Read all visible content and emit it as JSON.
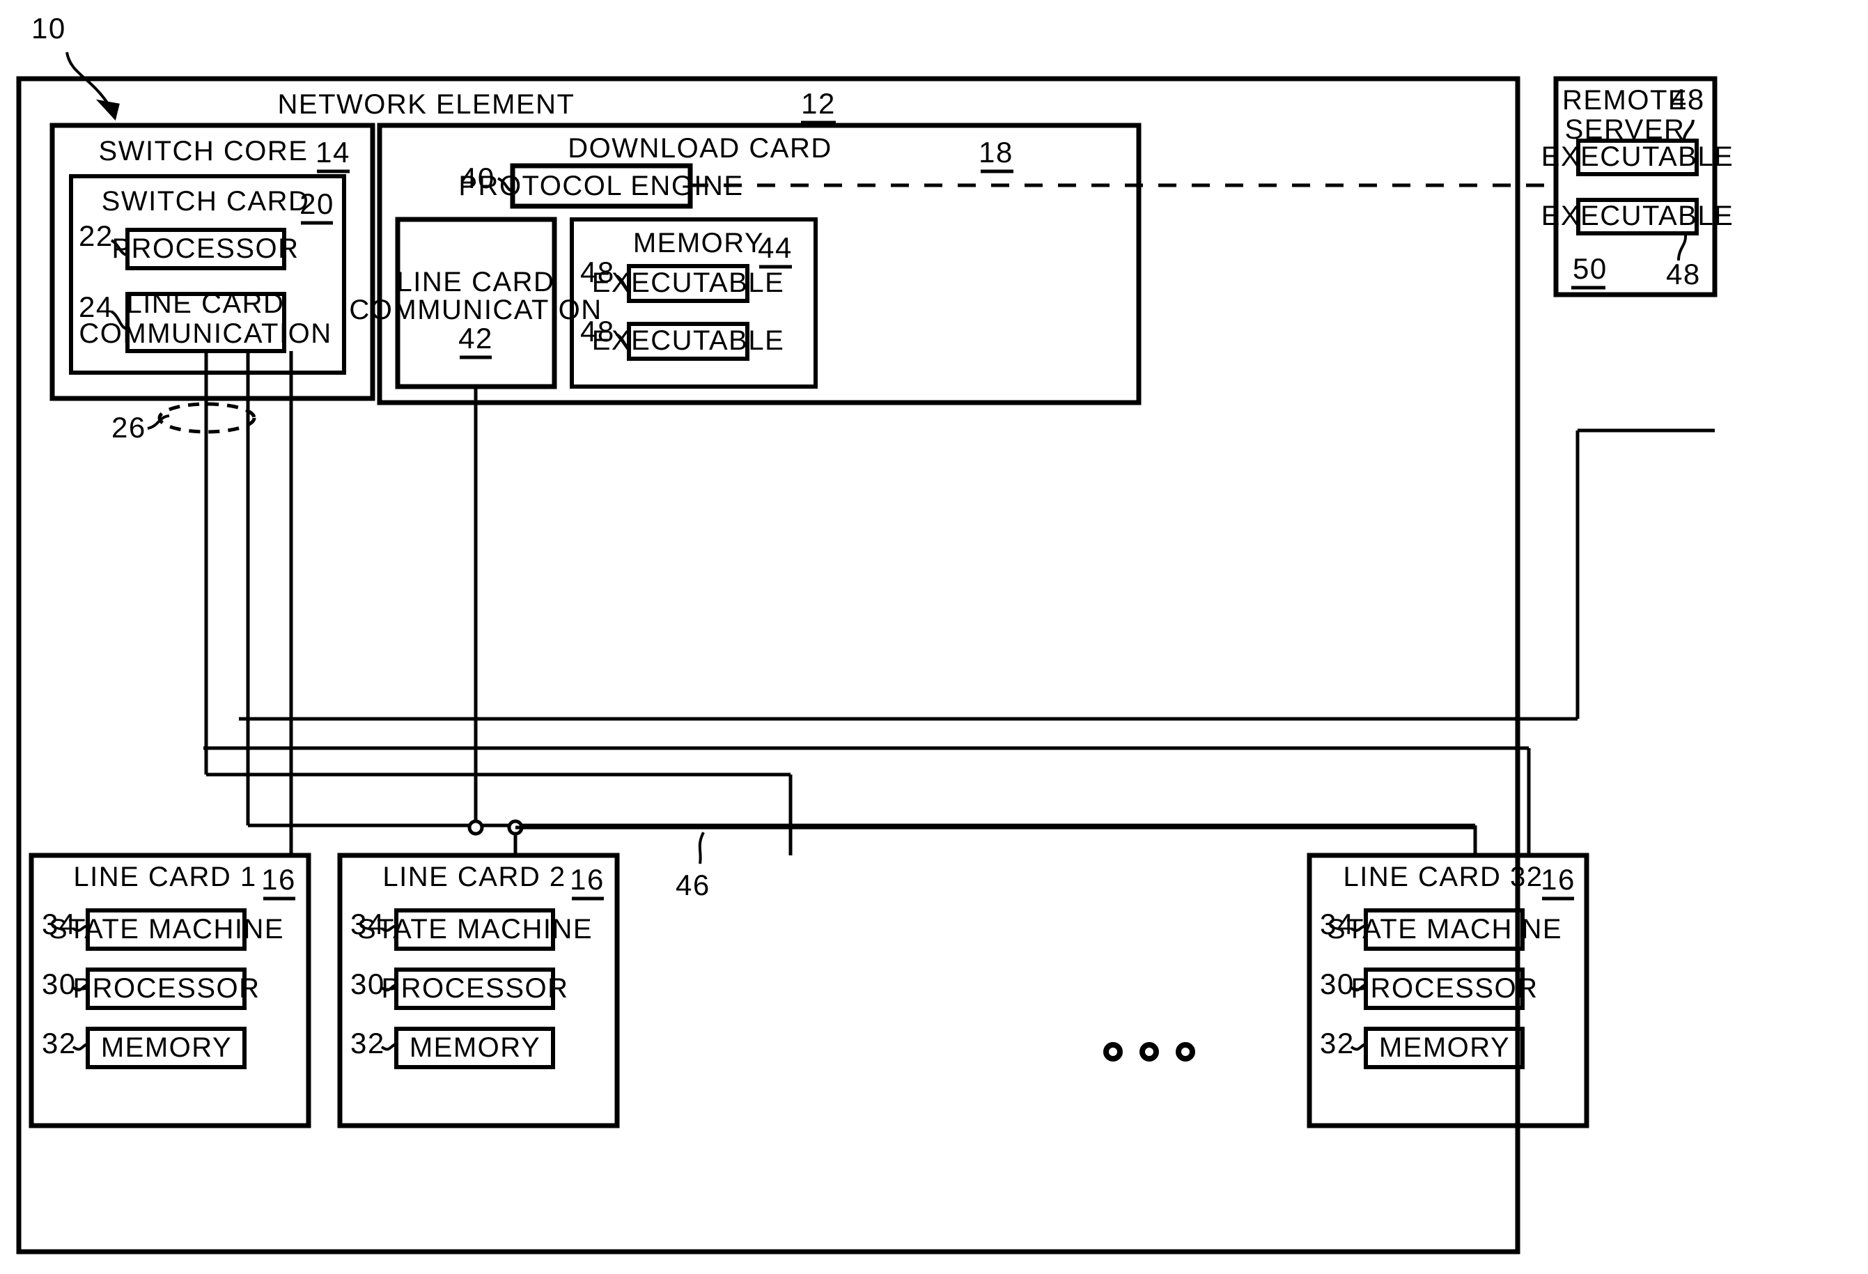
{
  "figure": {
    "root_ref": "10",
    "network_element": {
      "title": "NETWORK ELEMENT",
      "ref": "12"
    },
    "switch_core": {
      "title": "SWITCH CORE",
      "ref": "14",
      "switch_card": {
        "title": "SWITCH CARD",
        "ref": "20",
        "blocks": [
          {
            "label": "PROCESSOR",
            "ref": "22"
          },
          {
            "label": "LINE CARD\nCOMMUNICATION",
            "label_line1": "LINE CARD",
            "label_line2": "COMMUNICATION",
            "ref": "24"
          }
        ]
      }
    },
    "download_card": {
      "title": "DOWNLOAD CARD",
      "ref": "18",
      "protocol_engine": {
        "label": "PROTOCOL ENGINE",
        "ref": "40"
      },
      "line_card_communication": {
        "label_line1": "LINE CARD",
        "label_line2": "COMMUNICATION",
        "ref": "42"
      },
      "memory": {
        "title": "MEMORY",
        "ref": "44",
        "executables": [
          {
            "label": "EXECUTABLE",
            "ref": "48"
          },
          {
            "label": "EXECUTABLE",
            "ref": "48"
          }
        ]
      }
    },
    "remote_server": {
      "title_line1": "REMOTE",
      "title_line2": "SERVER",
      "ref": "50",
      "top_ref": "48",
      "bottom_ref": "48",
      "executables": [
        {
          "label": "EXECUTABLE"
        },
        {
          "label": "EXECUTABLE"
        }
      ]
    },
    "bus": {
      "ref": "26"
    },
    "download_bus": {
      "ref": "46"
    },
    "ellipsis": "o o o",
    "line_cards": [
      {
        "title": "LINE CARD 1",
        "ref": "16",
        "blocks": [
          {
            "label": "STATE MACHINE",
            "ref": "34"
          },
          {
            "label": "PROCESSOR",
            "ref": "30"
          },
          {
            "label": "MEMORY",
            "ref": "32"
          }
        ]
      },
      {
        "title": "LINE CARD 2",
        "ref": "16",
        "blocks": [
          {
            "label": "STATE MACHINE",
            "ref": "34"
          },
          {
            "label": "PROCESSOR",
            "ref": "30"
          },
          {
            "label": "MEMORY",
            "ref": "32"
          }
        ]
      },
      {
        "title": "LINE CARD 32",
        "ref": "16",
        "blocks": [
          {
            "label": "STATE MACHINE",
            "ref": "34"
          },
          {
            "label": "PROCESSOR",
            "ref": "30"
          },
          {
            "label": "MEMORY",
            "ref": "32"
          }
        ]
      }
    ]
  },
  "colors": {
    "line": "#000000",
    "background": "#ffffff"
  }
}
